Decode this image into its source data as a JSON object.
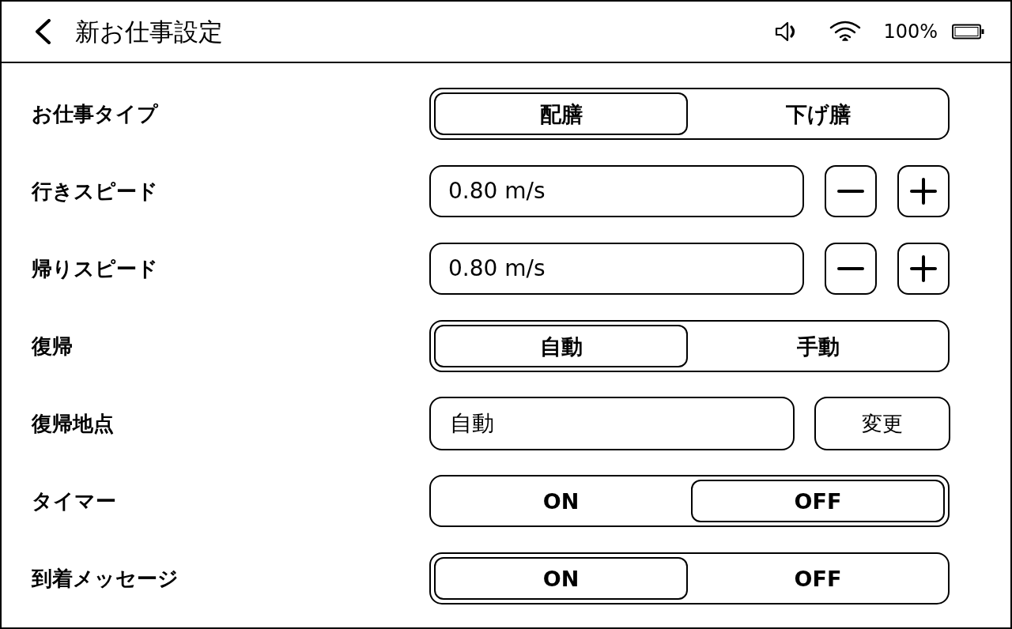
{
  "header": {
    "title": "新お仕事設定",
    "battery_text": "100%"
  },
  "settings": [
    {
      "kind": "segmented",
      "label": "お仕事タイプ",
      "options": [
        {
          "label": "配膳",
          "selected": true
        },
        {
          "label": "下げ膳",
          "selected": false
        }
      ]
    },
    {
      "kind": "stepper",
      "label": "行きスピード",
      "value": "0.80 m/s"
    },
    {
      "kind": "stepper",
      "label": "帰りスピード",
      "value": "0.80 m/s"
    },
    {
      "kind": "segmented",
      "label": "復帰",
      "options": [
        {
          "label": "自動",
          "selected": true
        },
        {
          "label": "手動",
          "selected": false
        }
      ]
    },
    {
      "kind": "picker",
      "label": "復帰地点",
      "value": "自動",
      "button": "変更"
    },
    {
      "kind": "segmented",
      "label": "タイマー",
      "options": [
        {
          "label": "ON",
          "selected": false
        },
        {
          "label": "OFF",
          "selected": true
        }
      ]
    },
    {
      "kind": "segmented",
      "label": "到着メッセージ",
      "options": [
        {
          "label": "ON",
          "selected": true
        },
        {
          "label": "OFF",
          "selected": false
        }
      ]
    }
  ]
}
